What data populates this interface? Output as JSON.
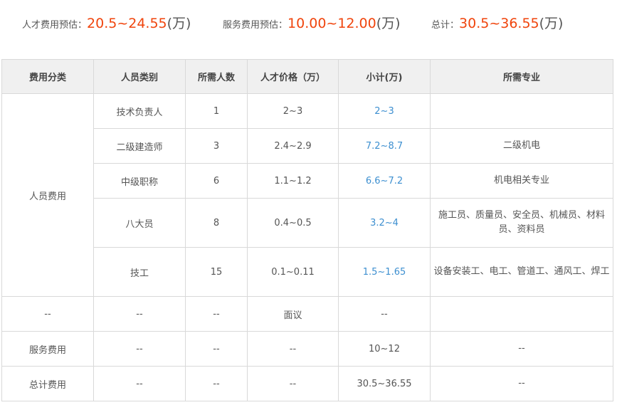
{
  "summary": {
    "talent": {
      "label": "人才费用预估：",
      "value": "20.5~24.55",
      "unit": "(万)"
    },
    "service": {
      "label": "服务费用预估：",
      "value": "10.00~12.00",
      "unit": "(万)"
    },
    "total": {
      "label": "总计：",
      "value": "30.5~36.55",
      "unit": "(万)"
    }
  },
  "colors": {
    "highlight": "#f0440c",
    "link_blue": "#3d8fd0",
    "header_bg": "#f0f0f0",
    "border": "#d9d9d9"
  },
  "table": {
    "headers": [
      "费用分类",
      "人员类别",
      "所需人数",
      "人才价格（万）",
      "小计(万)",
      "所需专业"
    ],
    "personnel_category": "人员费用",
    "personnel_rows": [
      {
        "type": "技术负责人",
        "count": "1",
        "price": "2~3",
        "subtotal": "2~3",
        "major": ""
      },
      {
        "type": "二级建造师",
        "count": "3",
        "price": "2.4~2.9",
        "subtotal": "7.2~8.7",
        "major": "二级机电"
      },
      {
        "type": "中级职称",
        "count": "6",
        "price": "1.1~1.2",
        "subtotal": "6.6~7.2",
        "major": "机电相关专业"
      },
      {
        "type": "八大员",
        "count": "8",
        "price": "0.4~0.5",
        "subtotal": "3.2~4",
        "major": "施工员、质量员、安全员、机械员、材料员、资料员"
      },
      {
        "type": "技工",
        "count": "15",
        "price": "0.1~0.11",
        "subtotal": "1.5~1.65",
        "major": "设备安装工、电工、管道工、通风工、焊工"
      }
    ],
    "other_rows": [
      {
        "category": "--",
        "type": "--",
        "count": "--",
        "price": "面议",
        "subtotal": "--",
        "major": ""
      },
      {
        "category": "服务费用",
        "type": "--",
        "count": "--",
        "price": "--",
        "subtotal": "10~12",
        "major": "--"
      },
      {
        "category": "总计费用",
        "type": "--",
        "count": "--",
        "price": "--",
        "subtotal": "30.5~36.55",
        "major": "--"
      }
    ]
  }
}
